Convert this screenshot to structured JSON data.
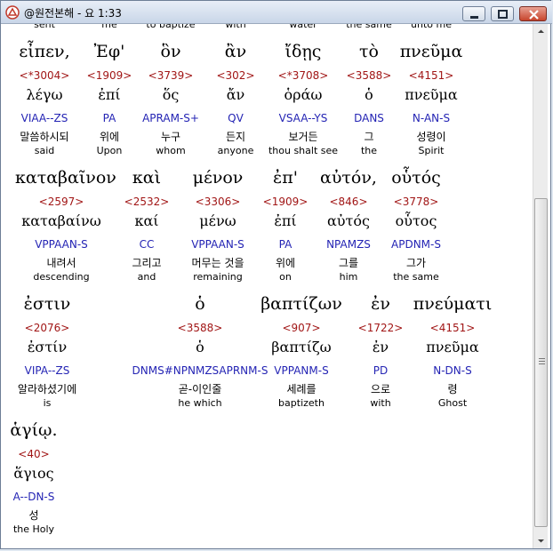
{
  "window": {
    "title": "@원전본해 - 요 1:33"
  },
  "top_partial": [
    "sent",
    "me",
    "to baptize",
    "with",
    "water",
    "the same",
    "unto me"
  ],
  "rows": [
    {
      "words": [
        {
          "word": "εἶπεν,",
          "strongs": "<*3004>",
          "lemma": "λέγω",
          "parsing": "VIAA--ZS",
          "korean": "말씀하시되",
          "english": "said"
        },
        {
          "word": "Ἐφ'",
          "strongs": "<1909>",
          "lemma": "ἐπί",
          "parsing": "PA",
          "korean": "위에",
          "english": "Upon"
        },
        {
          "word": "ὃν",
          "strongs": "<3739>",
          "lemma": "ὅς",
          "parsing": "APRAM-S+",
          "korean": "누구",
          "english": "whom"
        },
        {
          "word": "ἂν",
          "strongs": "<302>",
          "lemma": "ἄν",
          "parsing": "QV",
          "korean": "든지",
          "english": "anyone"
        },
        {
          "word": "ἴδῃς",
          "strongs": "<*3708>",
          "lemma": "ὁράω",
          "parsing": "VSAA--YS",
          "korean": "보거든",
          "english": "thou shalt see"
        },
        {
          "word": "τὸ",
          "strongs": "<3588>",
          "lemma": "ὁ",
          "parsing": "DANS",
          "korean": "그",
          "english": "the"
        },
        {
          "word": "πνεῦμα",
          "strongs": "<4151>",
          "lemma": "πνεῦμα",
          "parsing": "N-AN-S",
          "korean": "성령이",
          "english": "Spirit"
        }
      ]
    },
    {
      "words": [
        {
          "word": "καταβαῖνον",
          "strongs": "<2597>",
          "lemma": "καταβαίνω",
          "parsing": "VPPAAN-S",
          "korean": "내려서",
          "english": "descending"
        },
        {
          "word": "καὶ",
          "strongs": "<2532>",
          "lemma": "καί",
          "parsing": "CC",
          "korean": "그리고",
          "english": "and"
        },
        {
          "word": "μένον",
          "strongs": "<3306>",
          "lemma": "μένω",
          "parsing": "VPPAAN-S",
          "korean": "머무는 것을",
          "english": "remaining"
        },
        {
          "word": "ἐπ'",
          "strongs": "<1909>",
          "lemma": "ἐπί",
          "parsing": "PA",
          "korean": "위에",
          "english": "on"
        },
        {
          "word": "αὐτόν,",
          "strongs": "<846>",
          "lemma": "αὐτός",
          "parsing": "NPAMZS",
          "korean": "그를",
          "english": "him"
        },
        {
          "word": "οὗτός",
          "strongs": "<3778>",
          "lemma": "οὗτος",
          "parsing": "APDNM-S",
          "korean": "그가",
          "english": "the same"
        }
      ]
    },
    {
      "words": [
        {
          "word": "ἐστιν",
          "strongs": "<2076>",
          "lemma": "ἐστίν",
          "parsing": "VIPA--ZS",
          "korean": "알라하셨기에",
          "english": "is"
        },
        {
          "word": "ὁ",
          "strongs": "<3588>",
          "lemma": "ὁ",
          "parsing": "DNMS#NPNMZSAPRNM-S",
          "korean": "곧-이인줄",
          "english": "he which"
        },
        {
          "word": "βαπτίζων",
          "strongs": "<907>",
          "lemma": "βαπτίζω",
          "parsing": "VPPANM-S",
          "korean": "세례를",
          "english": "baptizeth"
        },
        {
          "word": "ἐν",
          "strongs": "<1722>",
          "lemma": "ἐν",
          "parsing": "PD",
          "korean": "으로",
          "english": "with"
        },
        {
          "word": "πνεύματι",
          "strongs": "<4151>",
          "lemma": "πνεῦμα",
          "parsing": "N-DN-S",
          "korean": "령",
          "english": "Ghost"
        }
      ]
    },
    {
      "words": [
        {
          "word": "ἁγίῳ.",
          "strongs": "<40>",
          "lemma": "ἅγιος",
          "parsing": "A--DN-S",
          "korean": "성",
          "english": "the Holy"
        }
      ]
    }
  ]
}
